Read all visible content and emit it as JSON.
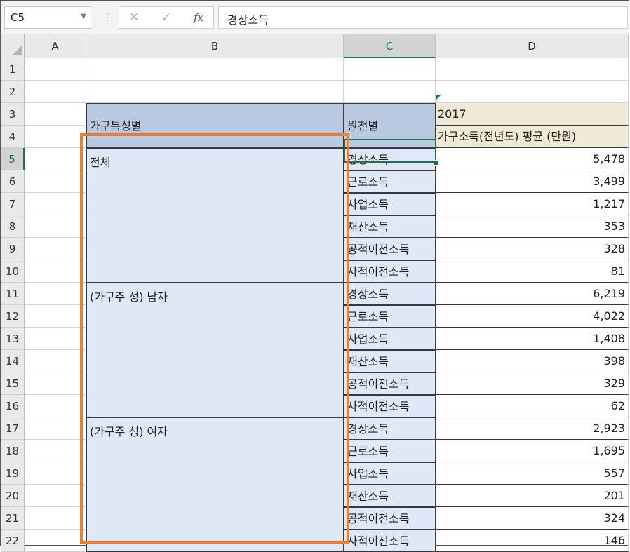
{
  "namebox": {
    "value": "C5"
  },
  "formula": {
    "value": "경상소득"
  },
  "columns": [
    "A",
    "B",
    "C",
    "D"
  ],
  "rows": [
    "1",
    "2",
    "3",
    "4",
    "5",
    "6",
    "7",
    "8",
    "9",
    "10",
    "11",
    "12",
    "13",
    "14",
    "15",
    "16",
    "17",
    "18",
    "19",
    "20",
    "21",
    "22"
  ],
  "header": {
    "group": "가구특성별",
    "source": "원천별",
    "year": "2017",
    "measure": "가구소득(전년도) 평균 (만원)"
  },
  "groups": [
    {
      "label": "전체",
      "items": [
        {
          "source": "경상소득",
          "value": "5,478"
        },
        {
          "source": "근로소득",
          "value": "3,499"
        },
        {
          "source": "사업소득",
          "value": "1,217"
        },
        {
          "source": "재산소득",
          "value": "353"
        },
        {
          "source": "공적이전소득",
          "value": "328"
        },
        {
          "source": "사적이전소득",
          "value": "81"
        }
      ]
    },
    {
      "label": "(가구주 성) 남자",
      "items": [
        {
          "source": "경상소득",
          "value": "6,219"
        },
        {
          "source": "근로소득",
          "value": "4,022"
        },
        {
          "source": "사업소득",
          "value": "1,408"
        },
        {
          "source": "재산소득",
          "value": "398"
        },
        {
          "source": "공적이전소득",
          "value": "329"
        },
        {
          "source": "사적이전소득",
          "value": "62"
        }
      ]
    },
    {
      "label": "(가구주 성) 여자",
      "items": [
        {
          "source": "경상소득",
          "value": "2,923"
        },
        {
          "source": "근로소득",
          "value": "1,695"
        },
        {
          "source": "사업소득",
          "value": "557"
        },
        {
          "source": "재산소득",
          "value": "201"
        },
        {
          "source": "공적이전소득",
          "value": "324"
        },
        {
          "source": "사적이전소득",
          "value": "146"
        }
      ]
    }
  ],
  "colors": {
    "accent": "#217346",
    "highlight": "#ed7d31",
    "header_fill": "#b8c9e1",
    "light_fill": "#dfe8f6"
  }
}
